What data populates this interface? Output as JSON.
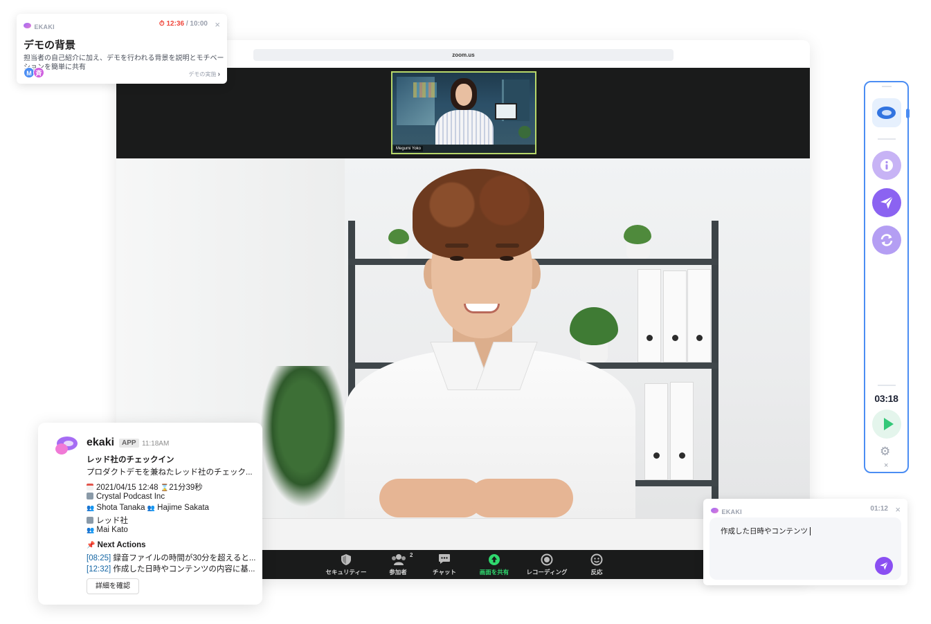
{
  "browser": {
    "url": "zoom.us"
  },
  "zoom": {
    "thumbnail_name": "Megumi Yoko",
    "toolbar": [
      {
        "label": "セキュリティー",
        "icon": "shield-icon"
      },
      {
        "label": "参加者",
        "icon": "participants-icon",
        "count": "2"
      },
      {
        "label": "チャット",
        "icon": "chat-icon"
      },
      {
        "label": "画面を共有",
        "icon": "share-screen-icon"
      },
      {
        "label": "レコーディング",
        "icon": "record-icon"
      },
      {
        "label": "反応",
        "icon": "reaction-icon"
      }
    ]
  },
  "notification": {
    "brand": "EKAKI",
    "timer_elapsed": "12:36",
    "timer_total": "/ 10:00",
    "title": "デモの背景",
    "body": "担当者の自己紹介に加え、デモを行われる背景を説明とモチベーションを簡単に共有",
    "avatars": [
      "M",
      "斉"
    ],
    "next_link": "デモの実施"
  },
  "side_panel": {
    "elapsed": "03:18",
    "buttons": [
      "info-icon",
      "send-icon",
      "refresh-icon"
    ]
  },
  "slack_message": {
    "app_name": "ekaki",
    "app_badge": "APP",
    "time": "11:18AM",
    "title": "レッド社のチェックイン",
    "summary": "プロダクトデモを兼ねたレッド社のチェック...",
    "date": "2021/04/15 12:48",
    "duration": "21分39秒",
    "company1": "Crystal Podcast Inc",
    "attendees1a": "Shota Tanaka",
    "attendees1b": "Hajime Sakata",
    "company2": "レッド社",
    "attendees2": "Mai Kato",
    "next_actions_title": "Next Actions",
    "action1_time": "08:25",
    "action1_text": "録音ファイルの時間が30分を超えると...",
    "action2_time": "12:32",
    "action2_text": "作成した日時やコンテンツの内容に基...",
    "details_button": "詳細を確認"
  },
  "compose": {
    "brand": "EKAKI",
    "time": "01:12",
    "text": "作成した日時やコンテンツ"
  },
  "colors": {
    "accent_blue": "#4b8df3",
    "brand_purple": "#8a4ff2",
    "timer_red": "#f0453a",
    "share_green": "#2fd86e"
  }
}
